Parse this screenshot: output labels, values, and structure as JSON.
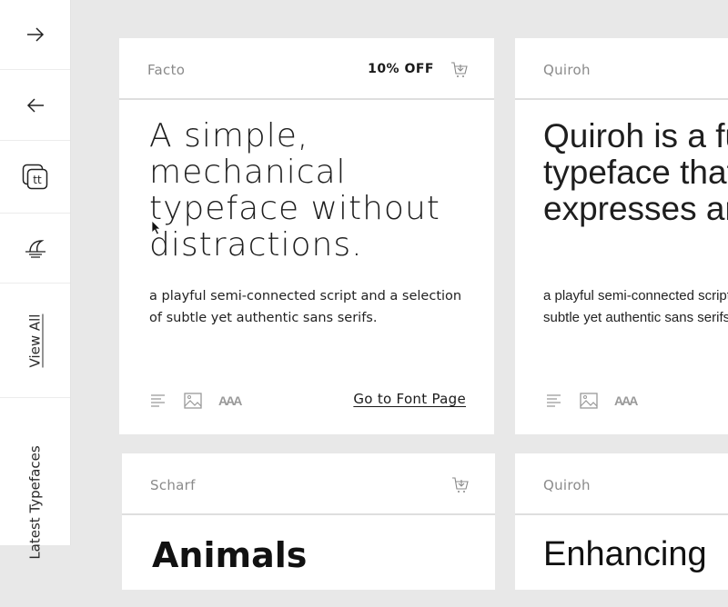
{
  "sidebar": {
    "next_icon": "arrow-right-icon",
    "prev_icon": "arrow-left-icon",
    "brand_icon": "tt-stack-icon",
    "wave_icon": "wave-icon",
    "view_all_label": "View All",
    "section_label": "Latest Typefaces"
  },
  "cards": [
    {
      "name": "Facto",
      "discount": "10% OFF",
      "headline": "A simple, mechanical typeface without distractions.",
      "description": "a playful semi-connected script and a selection of subtle yet authentic sans serifs.",
      "link_label": "Go to Font Page",
      "tools": [
        "text-align-icon",
        "image-icon",
        "font-size-icon"
      ],
      "tool_text": "AAA"
    },
    {
      "name": "Quiroh",
      "headline": "Quiroh is a functional typeface that expresses artistic life.",
      "description": "a playful semi-connected script and a selection of subtle yet authentic sans serifs.",
      "tools": [
        "text-align-icon",
        "image-icon",
        "font-size-icon"
      ],
      "tool_text": "AAA"
    },
    {
      "name": "Scharf",
      "headline_peek": "Animals"
    },
    {
      "name": "Quiroh",
      "headline_peek": "Enhancing"
    }
  ]
}
